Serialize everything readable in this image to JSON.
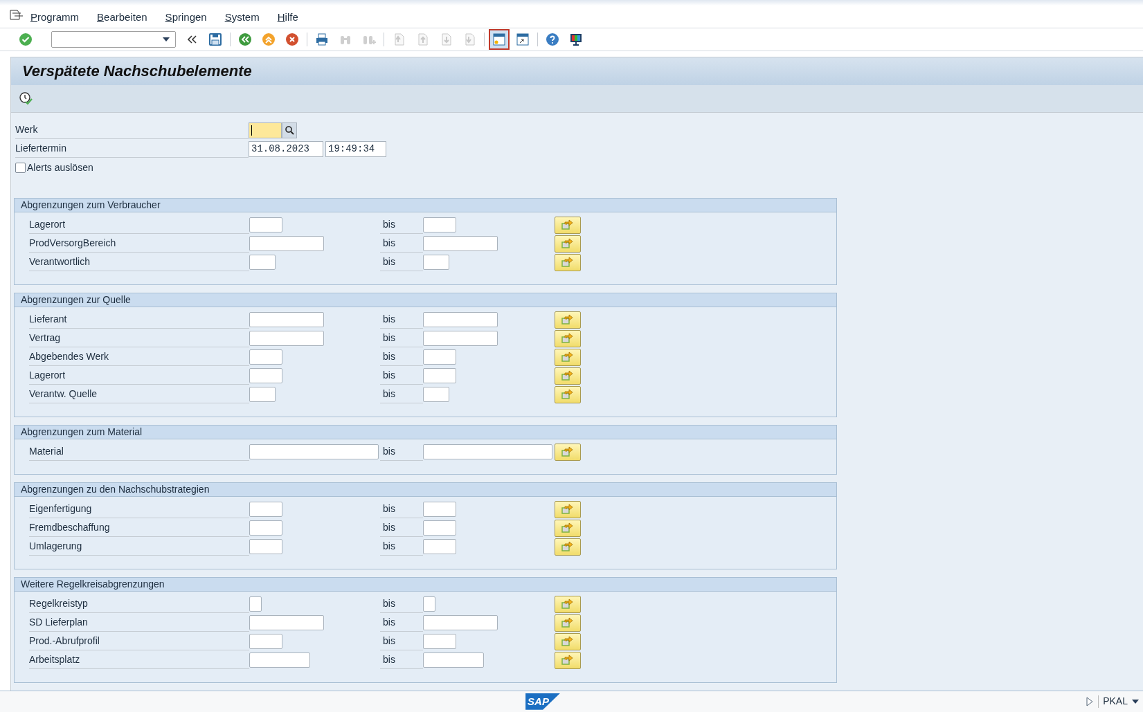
{
  "menu": [
    {
      "label": "Programm"
    },
    {
      "label": "Bearbeiten"
    },
    {
      "label": "Springen"
    },
    {
      "label": "System"
    },
    {
      "label": "Hilfe"
    }
  ],
  "toolbar": [
    [
      {
        "kind": "enter",
        "disabled": false,
        "selected": false
      }
    ],
    [
      {
        "kind": "command",
        "disabled": false,
        "selected": false
      },
      {
        "kind": "collapse",
        "disabled": false,
        "selected": false
      },
      {
        "kind": "save",
        "disabled": false,
        "selected": false
      }
    ],
    [
      {
        "kind": "back",
        "disabled": false,
        "selected": false
      },
      {
        "kind": "exit",
        "disabled": false,
        "selected": false
      },
      {
        "kind": "cancel",
        "disabled": false,
        "selected": false
      }
    ],
    [
      {
        "kind": "print",
        "disabled": false,
        "selected": false
      },
      {
        "kind": "find",
        "disabled": true,
        "selected": false
      },
      {
        "kind": "find_next",
        "disabled": true,
        "selected": false
      }
    ],
    [
      {
        "kind": "first_page",
        "disabled": true,
        "selected": false
      },
      {
        "kind": "prev_page",
        "disabled": true,
        "selected": false
      },
      {
        "kind": "next_page",
        "disabled": true,
        "selected": false
      },
      {
        "kind": "last_page",
        "disabled": true,
        "selected": false
      }
    ],
    [
      {
        "kind": "new_session",
        "disabled": false,
        "selected": true
      },
      {
        "kind": "shortcut",
        "disabled": false,
        "selected": false
      }
    ],
    [
      {
        "kind": "help",
        "disabled": false,
        "selected": false
      },
      {
        "kind": "layout",
        "disabled": false,
        "selected": false
      }
    ]
  ],
  "title": "Verspätete Nachschubelemente",
  "header_fields": [
    {
      "kind": "search",
      "label": "Werk",
      "focused": true
    },
    {
      "kind": "datetime",
      "label": "Liefertermin",
      "date": "31.08.2023",
      "time": "19:49:34"
    },
    {
      "kind": "checkbox",
      "label": "Alerts auslösen",
      "checked": false
    }
  ],
  "groups": [
    {
      "title": "Abgrenzungen zum Verbraucher",
      "rows": [
        {
          "label": "Lagerort",
          "kind": "short",
          "to_label": "bis"
        },
        {
          "label": "ProdVersorgBereich",
          "kind": "long",
          "to_label": "bis"
        },
        {
          "label": "Verantwortlich",
          "kind": "tiny",
          "to_label": "bis"
        }
      ]
    },
    {
      "title": "Abgrenzungen zur Quelle",
      "rows": [
        {
          "label": "Lieferant",
          "kind": "long",
          "to_label": "bis"
        },
        {
          "label": "Vertrag",
          "kind": "long",
          "to_label": "bis"
        },
        {
          "label": "Abgebendes Werk",
          "kind": "short",
          "to_label": "bis"
        },
        {
          "label": "Lagerort",
          "kind": "short",
          "to_label": "bis"
        },
        {
          "label": "Verantw. Quelle",
          "kind": "tiny",
          "to_label": "bis"
        }
      ]
    },
    {
      "title": "Abgrenzungen zum Material",
      "rows": [
        {
          "label": "Material",
          "kind": "full",
          "to_label": "bis"
        }
      ]
    },
    {
      "title": "Abgrenzungen zu den Nachschubstrategien",
      "rows": [
        {
          "label": "Eigenfertigung",
          "kind": "short",
          "to_label": "bis"
        },
        {
          "label": "Fremdbeschaffung",
          "kind": "short",
          "to_label": "bis"
        },
        {
          "label": "Umlagerung",
          "kind": "short",
          "to_label": "bis"
        }
      ]
    },
    {
      "title": "Weitere Regelkreisabgrenzungen",
      "rows": [
        {
          "label": "Regelkreistyp",
          "kind": "char",
          "to_label": "bis"
        },
        {
          "label": "SD Lieferplan",
          "kind": "long",
          "to_label": "bis"
        },
        {
          "label": "Prod.-Abrufprofil",
          "kind": "short",
          "to_label": "bis"
        },
        {
          "label": "Arbeitsplatz",
          "kind": "medium",
          "to_label": "bis"
        }
      ]
    }
  ],
  "status_bar": {
    "logo": "SAP",
    "system": "PKAL"
  }
}
